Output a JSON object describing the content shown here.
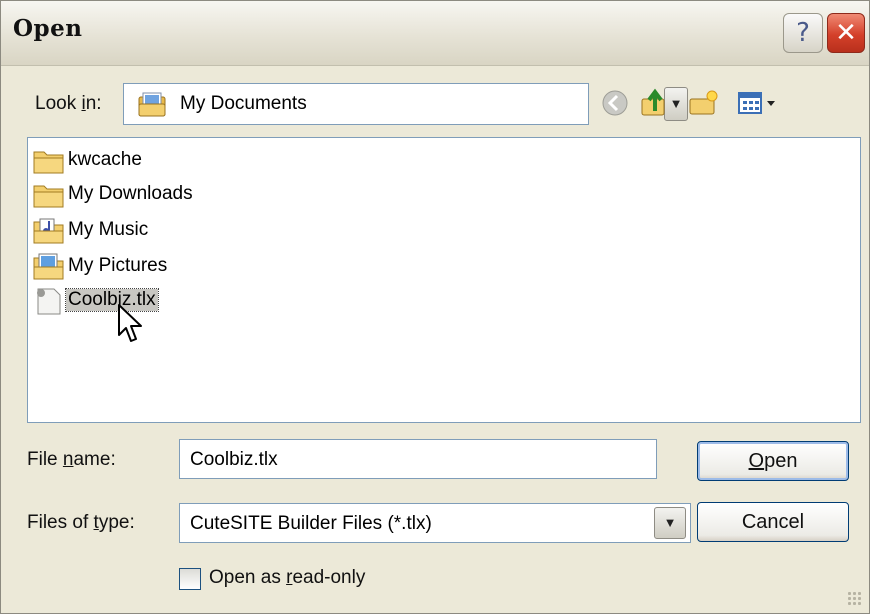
{
  "window": {
    "title": "Open",
    "help_glyph": "?",
    "close_glyph": "✕"
  },
  "toolbar": {
    "look_in_label_pre": "Look ",
    "look_in_label_ul": "i",
    "look_in_label_post": "n:",
    "look_in_value": "My Documents",
    "icons": [
      "back-icon",
      "up-folder-icon",
      "new-folder-icon",
      "view-menu-icon"
    ]
  },
  "files": [
    {
      "name": "kwcache",
      "icon": "folder-icon"
    },
    {
      "name": "My Downloads",
      "icon": "folder-icon"
    },
    {
      "name": "My Music",
      "icon": "music-folder-icon"
    },
    {
      "name": "My Pictures",
      "icon": "pictures-folder-icon"
    },
    {
      "name": "Coolbiz.tlx",
      "icon": "file-icon",
      "selected": true
    }
  ],
  "form": {
    "file_name_label_pre": "File ",
    "file_name_label_ul": "n",
    "file_name_label_post": "ame:",
    "file_name_value": "Coolbiz.tlx",
    "file_type_label_pre": "Files of ",
    "file_type_label_ul": "t",
    "file_type_label_post": "ype:",
    "file_type_value": "CuteSITE Builder Files (*.tlx)",
    "readonly_pre": "Open as ",
    "readonly_ul": "r",
    "readonly_post": "ead-only"
  },
  "buttons": {
    "open_ul": "O",
    "open_rest": "pen",
    "cancel": "Cancel"
  },
  "colors": {
    "dialog_bg": "#ece9d8",
    "field_border": "#7f9db9",
    "close_red": "#d4402a",
    "selection": "#c8c7c2"
  }
}
